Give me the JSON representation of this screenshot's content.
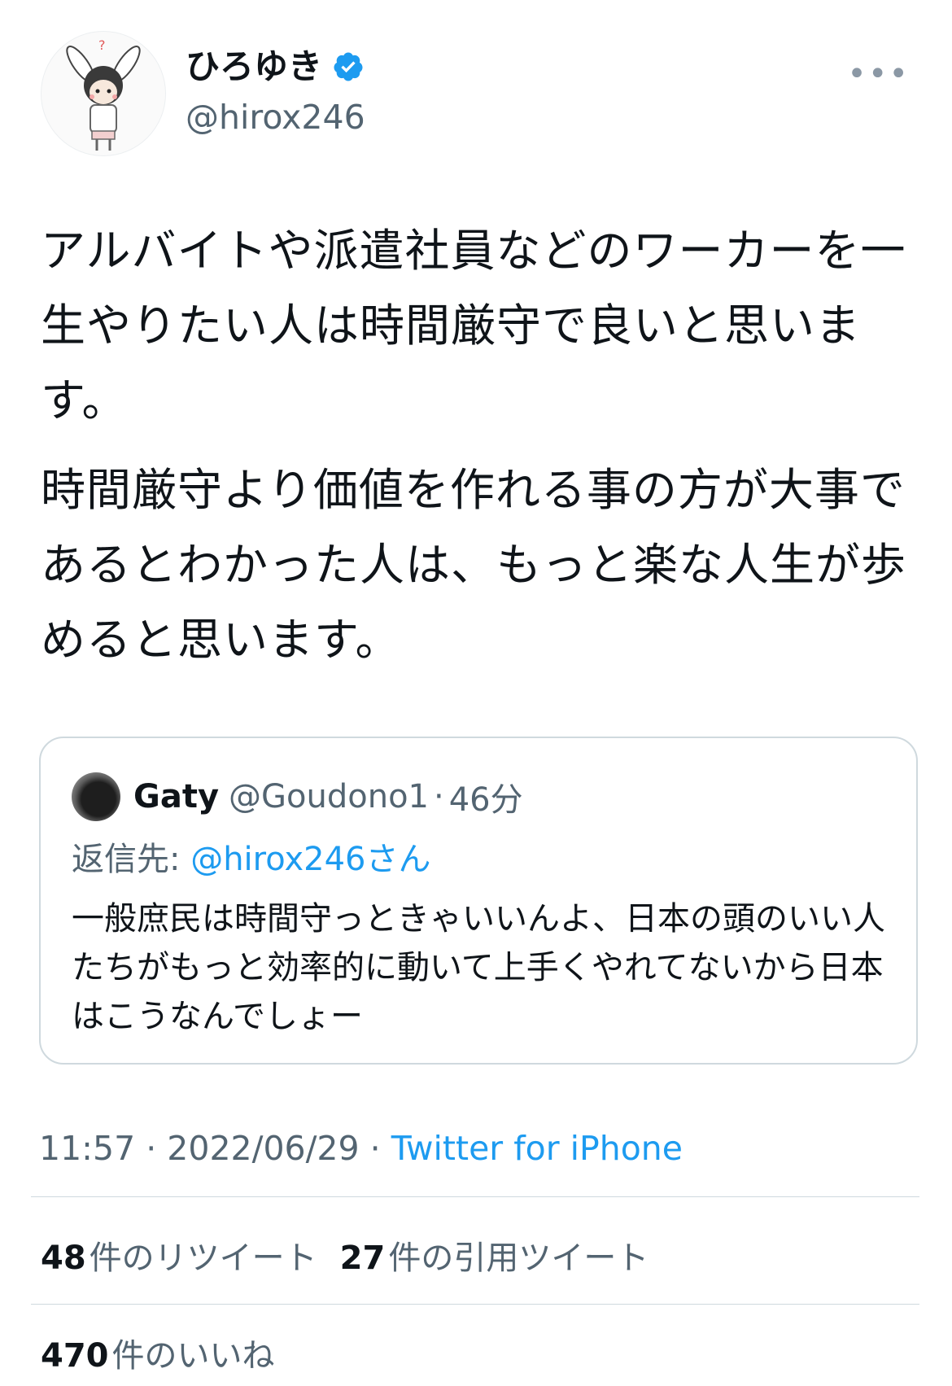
{
  "author": {
    "display_name": "ひろゆき",
    "handle": "@hirox246",
    "verified_color": "#1d9bf0",
    "more_icon": "more-horizontal-icon"
  },
  "tweet": {
    "paragraphs": [
      "アルバイトや派遣社員などのワーカーを一生やりたい人は時間厳守で良いと思います。",
      "時間厳守より価値を作れる事の方が大事であるとわかった人は、もっと楽な人生が歩めると思います。"
    ]
  },
  "quote": {
    "name": "Gaty",
    "handle": "@Goudono1",
    "separator": "·",
    "time": "46分",
    "reply_prefix": "返信先:",
    "reply_handle": "@hirox246",
    "reply_suffix": "さん",
    "text": "一般庶民は時間守っときゃいいんよ、日本の頭のいい人たちがもっと効率的に動いて上手くやれてないから日本はこうなんでしょー"
  },
  "meta": {
    "time": "11:57",
    "separator": "·",
    "date": "2022/06/29",
    "source": "Twitter for iPhone"
  },
  "stats": {
    "retweets_count": "48",
    "retweets_label": "件のリツイート",
    "quotes_count": "27",
    "quotes_label": "件の引用ツイート",
    "likes_count": "470",
    "likes_label": "件のいいね"
  },
  "colors": {
    "accent": "#1d9bf0",
    "text": "#0f1419",
    "secondary": "#536471",
    "border": "#cfd9de"
  }
}
